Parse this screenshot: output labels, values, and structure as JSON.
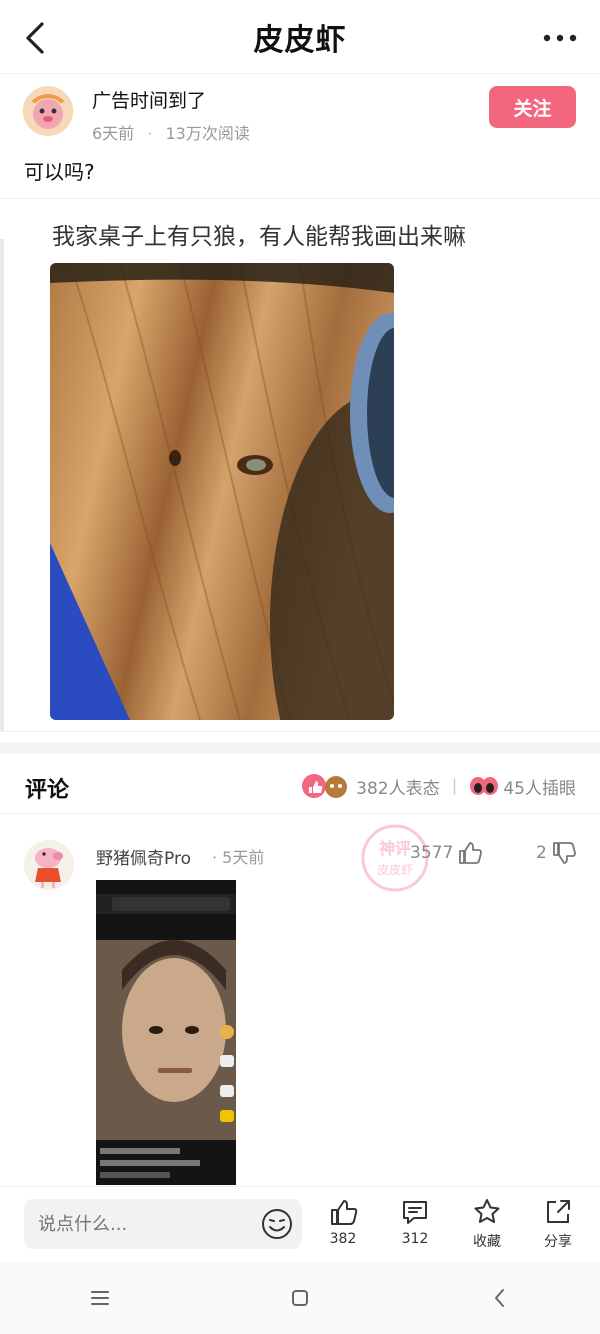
{
  "header": {
    "title": "皮皮虾"
  },
  "author": {
    "name": "广告时间到了",
    "time": "6天前",
    "reads": "13万次阅读",
    "follow_label": "关注"
  },
  "post": {
    "text": "可以吗?",
    "image_caption": "我家桌子上有只狼，有人能帮我画出来嘛"
  },
  "comments": {
    "title": "评论",
    "reactions_count": "382人表态",
    "eyes_count": "45人插眼",
    "items": [
      {
        "user": "野猪佩奇Pro",
        "time": "5天前",
        "likes": "3577",
        "dislikes": "2",
        "watermark_top": "神评",
        "watermark_bottom": "皮皮虾"
      }
    ]
  },
  "bottom": {
    "input_placeholder": "说点什么...",
    "like_count": "382",
    "comment_count": "312",
    "favorite_label": "收藏",
    "share_label": "分享"
  },
  "colors": {
    "accent": "#f2667e"
  }
}
